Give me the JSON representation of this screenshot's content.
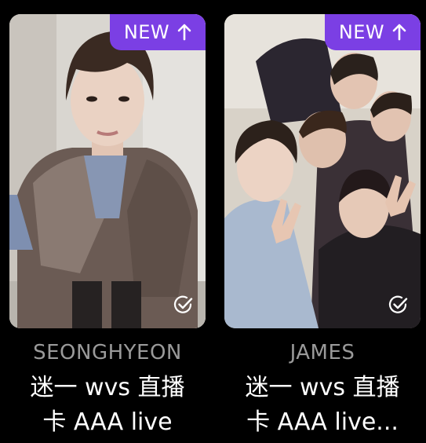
{
  "colors": {
    "background": "#000000",
    "badge": "#7b3fe4",
    "name_text": "#9a9a9a",
    "title_text": "#ffffff"
  },
  "cards": [
    {
      "badge_label": "NEW",
      "badge_icon": "arrow-up-icon",
      "check_icon": "check-circle-icon",
      "artist": "SEONGHYEON",
      "title_line1": "迷一 wvs 直播",
      "title_line2": "卡 AAA live"
    },
    {
      "badge_label": "NEW",
      "badge_icon": "arrow-up-icon",
      "check_icon": "check-circle-icon",
      "artist": "JAMES",
      "title_line1": "迷一 wvs 直播",
      "title_line2": "卡 AAA live..."
    }
  ]
}
